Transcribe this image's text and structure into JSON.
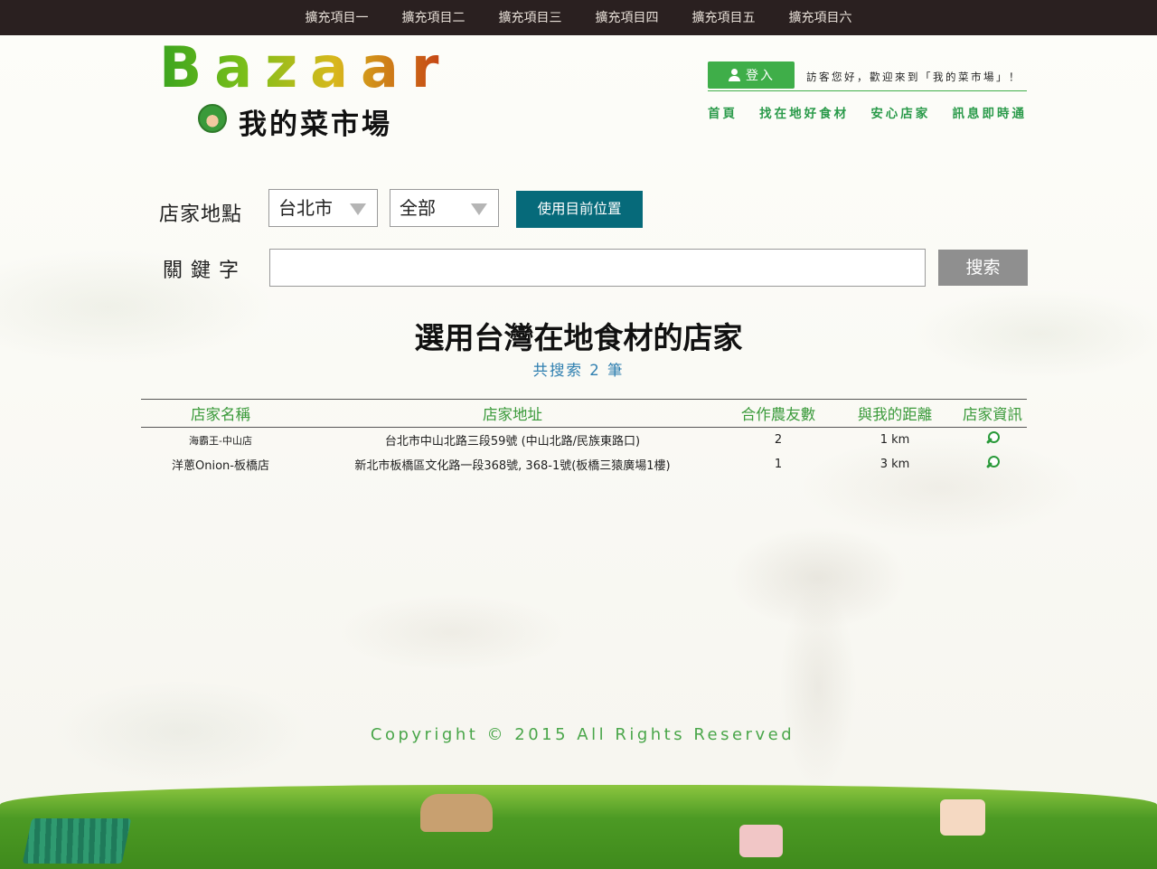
{
  "top_nav": {
    "items": [
      "擴充項目一",
      "擴充項目二",
      "擴充項目三",
      "擴充項目四",
      "擴充項目五",
      "擴充項目六"
    ]
  },
  "logo": {
    "word": "Bazaar",
    "subtitle": "我的菜市場"
  },
  "header": {
    "login_label": "登入",
    "greeting": "訪客您好，歡迎來到「我的菜市場」！",
    "nav": [
      "首頁",
      "找在地好食材",
      "安心店家",
      "訊息即時通"
    ]
  },
  "search": {
    "location_label": "店家地點",
    "city_selected": "台北市",
    "district_selected": "全部",
    "use_location_label": "使用目前位置",
    "keyword_label": "關鍵字",
    "keyword_value": "",
    "search_label": "搜索"
  },
  "results": {
    "title": "選用台灣在地食材的店家",
    "count_text": "共搜索 2 筆",
    "columns": [
      "店家名稱",
      "店家地址",
      "合作農友數",
      "與我的距離",
      "店家資訊"
    ],
    "rows": [
      {
        "name": "海霸王-中山店",
        "address": "台北市中山北路三段59號 (中山北路/民族東路口)",
        "farmers": "2",
        "distance": "1 km"
      },
      {
        "name": "洋蔥Onion-板橋店",
        "address": "新北市板橋區文化路一段368號, 368-1號(板橋三猿廣場1樓)",
        "farmers": "1",
        "distance": "3 km"
      }
    ]
  },
  "footer": {
    "copyright": "Copyright © 2015 All Rights Reserved"
  },
  "colors": {
    "brand_green": "#3fae49",
    "button_teal": "#066a7a",
    "search_gray": "#8f8f8f",
    "topbar": "#2a2020",
    "link_blue": "#2e7fb0"
  }
}
